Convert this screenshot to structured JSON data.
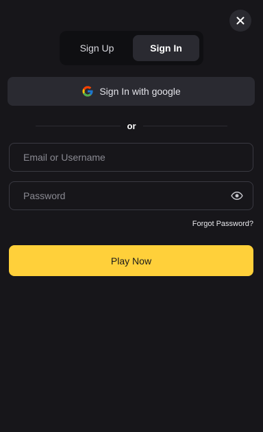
{
  "close": {
    "icon": "close-icon"
  },
  "tabs": [
    {
      "label": "Sign Up",
      "active": false
    },
    {
      "label": "Sign In",
      "active": true
    }
  ],
  "google": {
    "label": "Sign In with google",
    "icon": "google-icon"
  },
  "divider": {
    "label": "or"
  },
  "email": {
    "placeholder": "Email or Username",
    "value": ""
  },
  "password": {
    "placeholder": "Password",
    "value": "",
    "icon": "eye-icon"
  },
  "forgot_label": "Forgot Password?",
  "submit_label": "Play Now",
  "colors": {
    "background": "#17161a",
    "accent": "#ffd03a",
    "surface": "#2a2a31"
  }
}
